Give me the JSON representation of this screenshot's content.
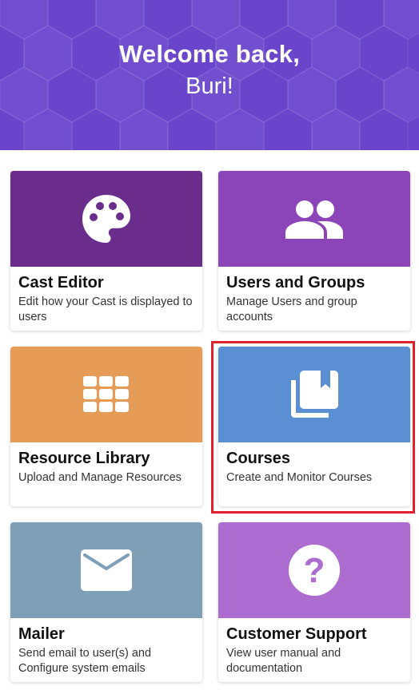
{
  "header": {
    "greeting": "Welcome back,",
    "user_name": "Buri!",
    "bg_color": "#6a45cc"
  },
  "cards": [
    {
      "title": "Cast Editor",
      "description": "Edit how your Cast is displayed to users",
      "color": "#6b2d8c",
      "icon": "palette-icon"
    },
    {
      "title": "Users and Groups",
      "description": "Manage Users and group accounts",
      "color": "#8c45b8",
      "icon": "users-icon"
    },
    {
      "title": "Resource Library",
      "description": "Upload and Manage Resources",
      "color": "#e69c57",
      "icon": "grid-icon"
    },
    {
      "title": "Courses",
      "description": "Create and Monitor Courses",
      "color": "#5b8fd4",
      "icon": "library-books-icon"
    },
    {
      "title": "Mailer",
      "description": "Send email to user(s) and Configure system emails",
      "color": "#7f9fb6",
      "icon": "mail-icon"
    },
    {
      "title": "Customer Support",
      "description": "View user manual and documentation",
      "color": "#ad6ccf",
      "icon": "help-icon"
    }
  ]
}
